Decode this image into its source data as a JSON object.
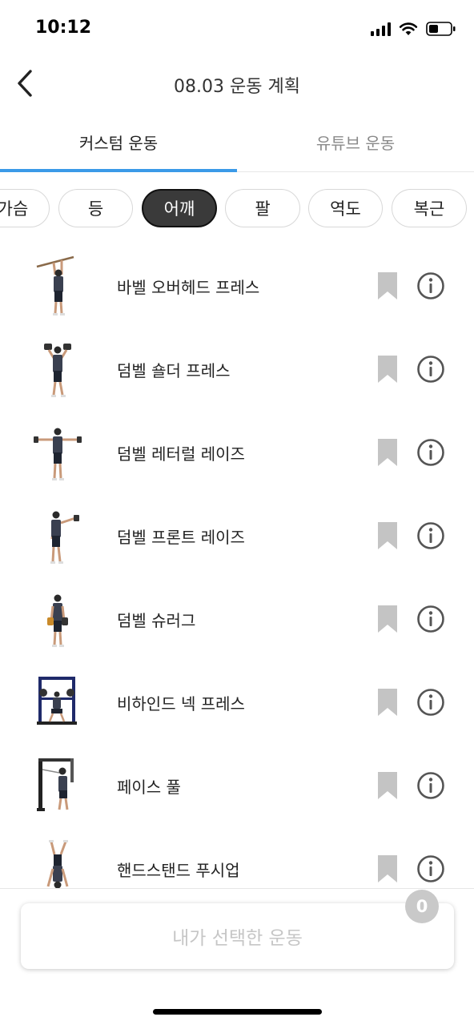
{
  "status_bar": {
    "time": "10:12"
  },
  "header": {
    "title": "08.03 운동 계획"
  },
  "tabs": [
    {
      "label": "커스텀 운동",
      "active": true
    },
    {
      "label": "유튜브 운동",
      "active": false
    }
  ],
  "categories": [
    {
      "label": "가슴",
      "selected": false
    },
    {
      "label": "등",
      "selected": false
    },
    {
      "label": "어깨",
      "selected": true
    },
    {
      "label": "팔",
      "selected": false
    },
    {
      "label": "역도",
      "selected": false
    },
    {
      "label": "복근",
      "selected": false
    }
  ],
  "exercises": [
    {
      "name": "바벨 오버헤드 프레스",
      "icon": "barbell-overhead-press-photo"
    },
    {
      "name": "덤벨 숄더 프레스",
      "icon": "dumbbell-shoulder-press-photo"
    },
    {
      "name": "덤벨 레터럴 레이즈",
      "icon": "dumbbell-lateral-raise-photo"
    },
    {
      "name": "덤벨 프론트 레이즈",
      "icon": "dumbbell-front-raise-photo"
    },
    {
      "name": "덤벨 슈러그",
      "icon": "dumbbell-shrug-photo"
    },
    {
      "name": "비하인드 넥 프레스",
      "icon": "behind-neck-press-photo"
    },
    {
      "name": "페이스 풀",
      "icon": "face-pull-photo"
    },
    {
      "name": "핸드스탠드 푸시업",
      "icon": "handstand-pushup-photo"
    }
  ],
  "bottom": {
    "selected_label": "내가 선택한 운동",
    "selected_count": "0"
  },
  "colors": {
    "accent": "#3b9ae8",
    "chip_selected_bg": "#3a3a3a",
    "bookmark": "#c4c4c4",
    "info": "#555555",
    "disabled_text": "#c6c6c6",
    "badge_bg": "#c9c9c9"
  }
}
